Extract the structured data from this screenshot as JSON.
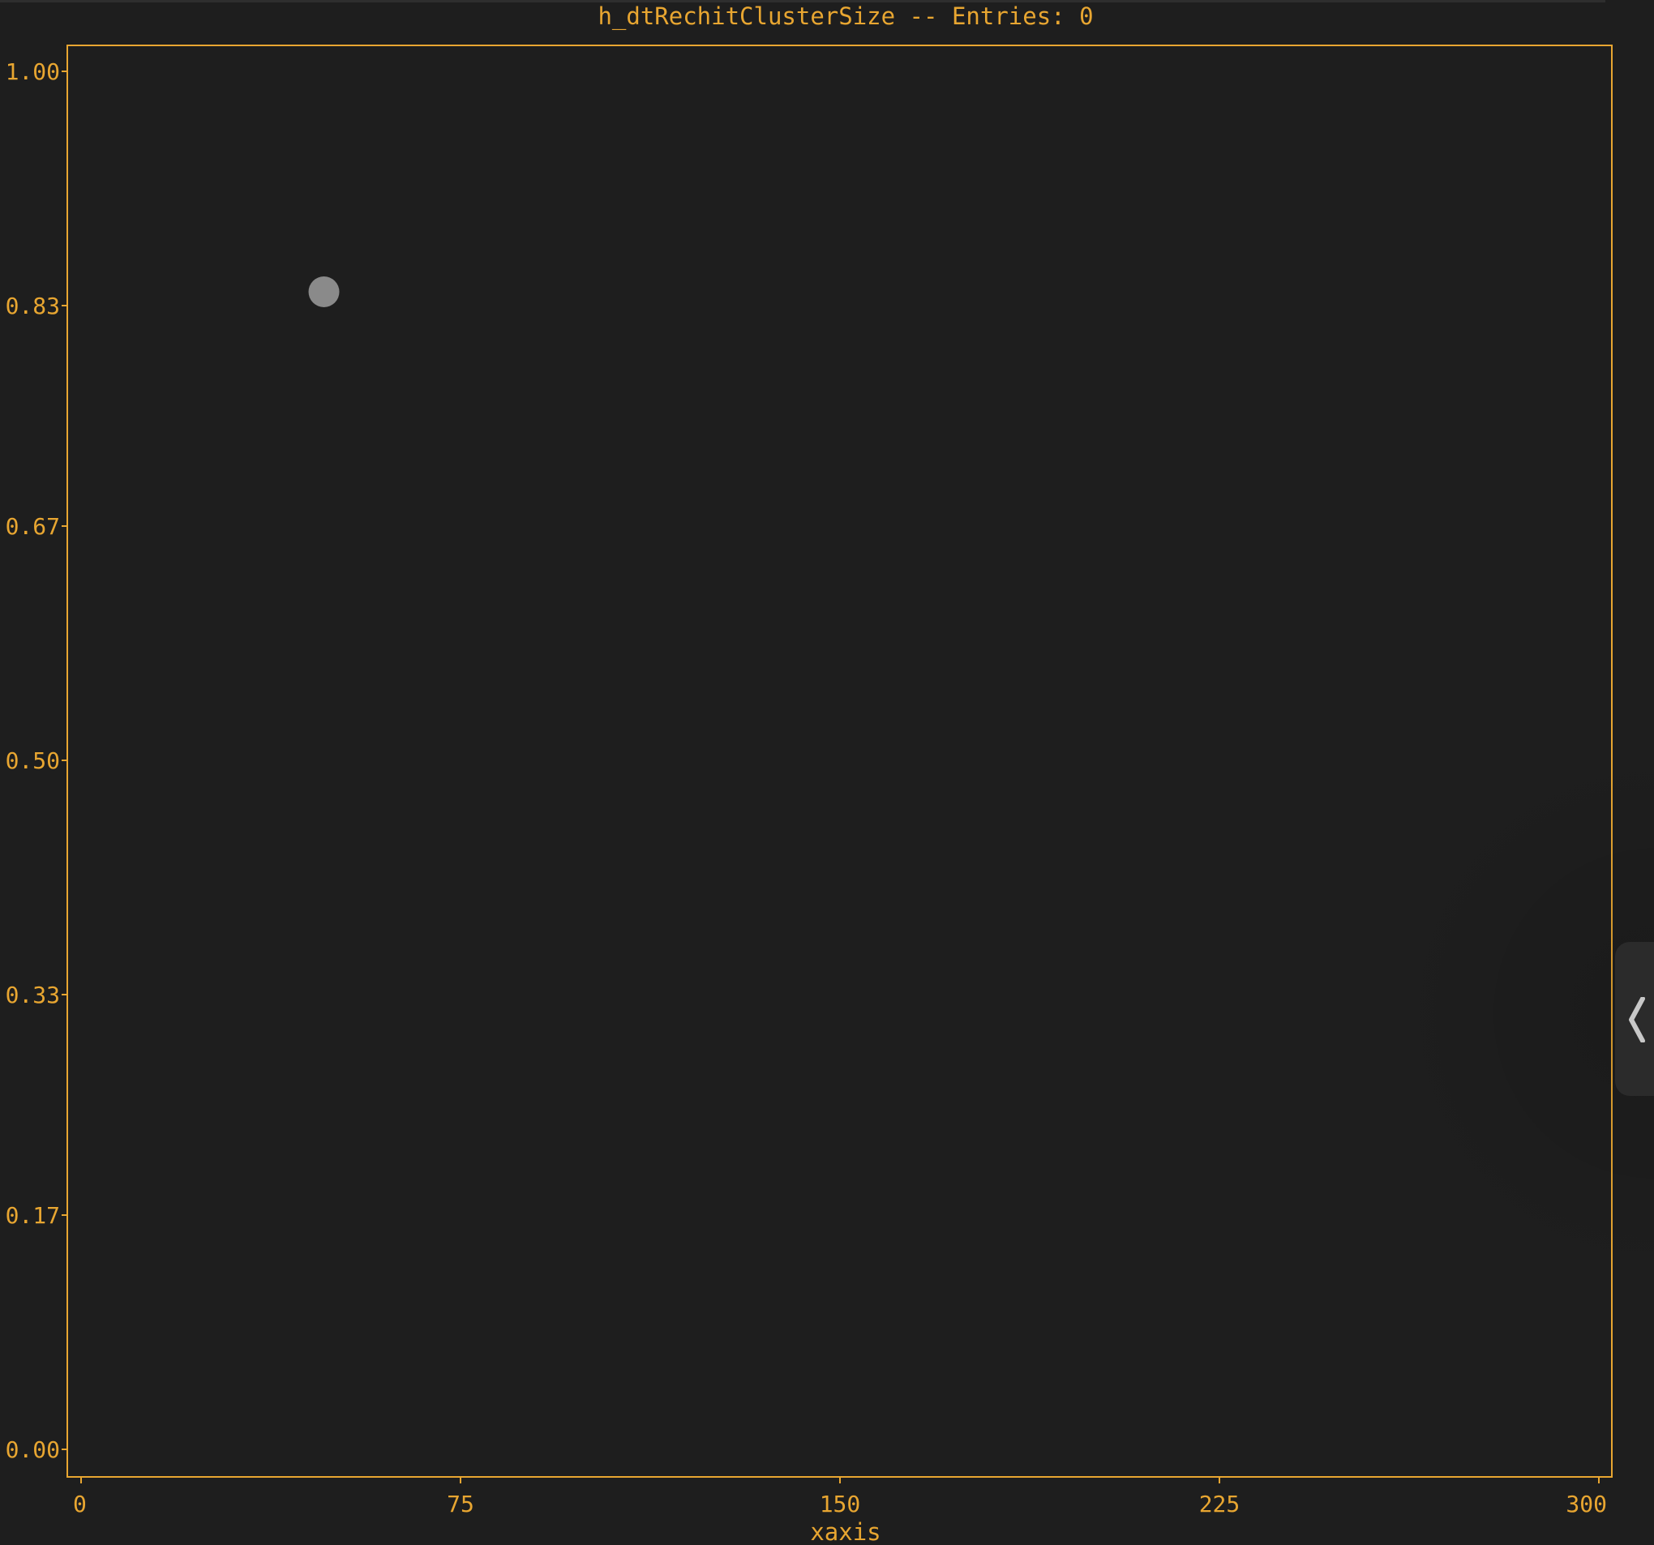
{
  "plot": {
    "title": "h_dtRechitClusterSize -- Entries: 0",
    "colors": {
      "background": "#1e1e1e",
      "axis": "#e8a631",
      "text": "#e8a631",
      "marker": "#8a8a8a",
      "handle": "#2b2b2b",
      "handle_icon": "#c8c8c8"
    },
    "handle_icon": "chevron-left-icon"
  },
  "chart_data": {
    "type": "scatter",
    "title": "h_dtRechitClusterSize -- Entries: 0",
    "xlabel": "xaxis",
    "ylabel": "",
    "xlim": [
      0,
      300
    ],
    "ylim": [
      0,
      1
    ],
    "x_ticks": [
      "0",
      "75",
      "150",
      "225",
      "300"
    ],
    "y_ticks": [
      "0.00",
      "0.17",
      "0.33",
      "0.50",
      "0.67",
      "0.83",
      "1.00"
    ],
    "points": [
      {
        "x": 48,
        "y": 0.84
      }
    ],
    "grid": false,
    "legend": "none"
  }
}
